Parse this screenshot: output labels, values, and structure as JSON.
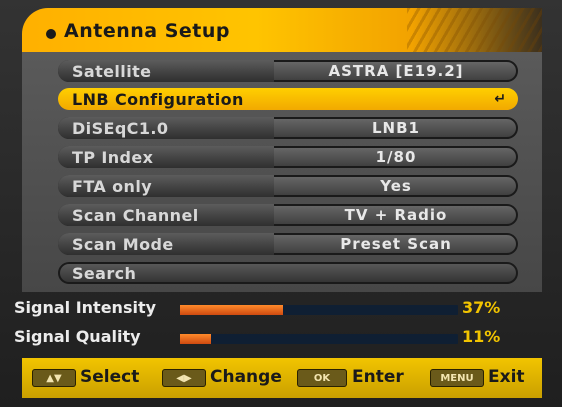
{
  "header": {
    "title": "Antenna Setup"
  },
  "menu": {
    "items": [
      {
        "label": "Satellite",
        "value": "ASTRA [E19.2]"
      },
      {
        "label": "LNB Configuration",
        "value": ""
      },
      {
        "label": "DiSEqC1.0",
        "value": "LNB1"
      },
      {
        "label": "TP Index",
        "value": "1/80"
      },
      {
        "label": "FTA only",
        "value": "Yes"
      },
      {
        "label": "Scan Channel",
        "value": "TV + Radio"
      },
      {
        "label": "Scan Mode",
        "value": "Preset Scan"
      },
      {
        "label": "Search",
        "value": ""
      }
    ],
    "selected_index": 1,
    "enter_icon": "return-enter-icon"
  },
  "signal": {
    "intensity": {
      "label": "Signal Intensity",
      "percent_text": "37%",
      "level": 0.37
    },
    "quality": {
      "label": "Signal Quality",
      "percent_text": "11%",
      "level": 0.11
    }
  },
  "footer": {
    "select": {
      "label": "Select",
      "icon": "up-down-keys-icon"
    },
    "change": {
      "label": "Change",
      "icon": "left-right-keys-icon"
    },
    "enter": {
      "label": "Enter",
      "key_text": "OK"
    },
    "exit": {
      "label": "Exit",
      "key_text": "MENU"
    }
  },
  "colors": {
    "accent": "#ffc400",
    "signal_fill": "#ff7a2a",
    "signal_track": "#0f1f33",
    "percent_text": "#f2c400"
  }
}
